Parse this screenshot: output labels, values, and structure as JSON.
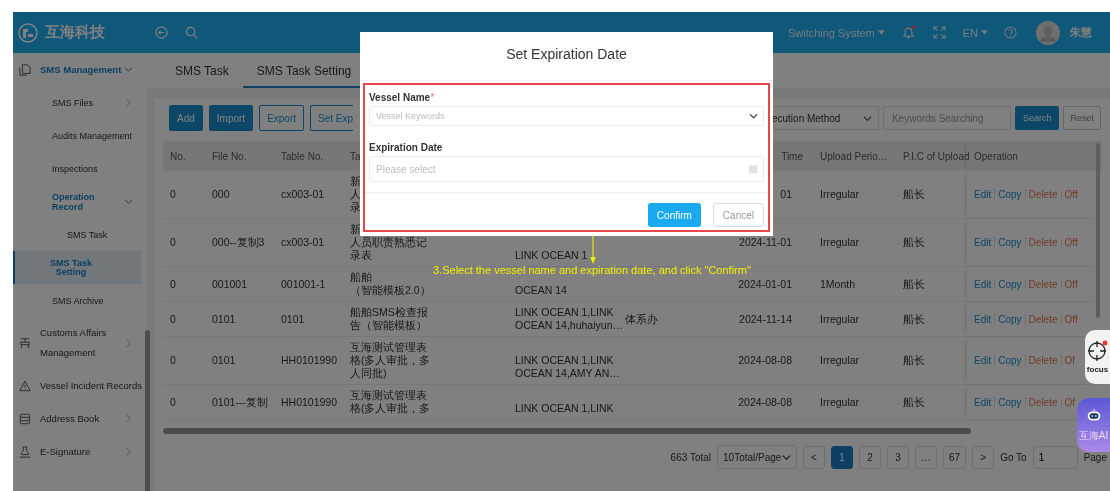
{
  "header": {
    "logo": "互海科技",
    "system_switch": "Switching System",
    "system_switch_expanded": false,
    "language": "EN",
    "language_expanded": false,
    "user_name": "朱慧",
    "has_notification": true
  },
  "sidebar": {
    "items": [
      {
        "label": "SMS Management",
        "expanded": true,
        "selected": false,
        "children": [
          {
            "label": "SMS Files",
            "expanded": false,
            "selected": false
          },
          {
            "label": "Audits Management",
            "selected": false
          },
          {
            "label": "Inspections",
            "selected": false
          },
          {
            "label": "Operation Record",
            "expanded": true,
            "selected": false,
            "children": [
              {
                "label": "SMS Task",
                "selected": false
              },
              {
                "label": "SMS Task Setting",
                "selected": true
              }
            ]
          },
          {
            "label": "SMS Archive",
            "selected": false
          }
        ]
      },
      {
        "label": "Customs Affairs Management",
        "expanded": false,
        "selected": false
      },
      {
        "label": "Vessel Incident Records",
        "selected": false
      },
      {
        "label": "Address Book",
        "expanded": false,
        "selected": false
      },
      {
        "label": "E-Signature",
        "expanded": false,
        "selected": false
      }
    ]
  },
  "tabs": [
    {
      "label": "SMS Task",
      "selected": false
    },
    {
      "label": "SMS Task Setting",
      "selected": true
    }
  ],
  "toolbar": {
    "buttons": [
      {
        "label": "Add",
        "kind": "primary"
      },
      {
        "label": "Import",
        "kind": "primary"
      },
      {
        "label": "Export",
        "kind": "outline"
      },
      {
        "label": "Set Exp",
        "kind": "outline"
      }
    ],
    "filter_select": "ecution Method",
    "search": {
      "placeholder": "Keywords Searching"
    },
    "search_button": "Search",
    "reset_button": "Reset"
  },
  "table": {
    "columns": {
      "no": "No.",
      "file_no": "File No.",
      "table_no": "Table No.",
      "column_4": "Ta",
      "column_7": "Time",
      "upload_period": "Upload Perio…",
      "pic": "P.I.C of Upload",
      "operation": "Operation"
    },
    "rows": [
      {
        "no": "0",
        "file_no": "000",
        "table_no": "cx003-01",
        "column_4": [
          "新",
          "人",
          "录"
        ],
        "column_7": "01",
        "upload_period": "Irregular",
        "pic": "船长",
        "actions": [
          {
            "label": "Edit",
            "kind": "edit"
          },
          {
            "label": "Copy",
            "kind": "copy"
          },
          {
            "label": "Delete",
            "kind": "delete"
          },
          {
            "label": "Off",
            "kind": "off"
          }
        ]
      },
      {
        "no": "0",
        "file_no": "000--复制3",
        "table_no": "cx003-01",
        "column_4": [
          "新",
          "人员职责熟悉记",
          "录表"
        ],
        "column_5": "LINK OCEAN 1",
        "column_7": "2024-11-01",
        "upload_period": "Irregular",
        "pic": "船长",
        "actions": [
          {
            "label": "Edit",
            "kind": "edit"
          },
          {
            "label": "Copy",
            "kind": "copy"
          },
          {
            "label": "Delete",
            "kind": "delete"
          },
          {
            "label": "Off",
            "kind": "off"
          }
        ]
      },
      {
        "no": "0",
        "file_no": "001001",
        "table_no": "001001-1",
        "column_4": [
          "船舶",
          "（智能模板2.0）"
        ],
        "column_5": "OCEAN 14",
        "column_7": "2024-01-01",
        "upload_period": "1Month",
        "pic": "船长",
        "actions": [
          {
            "label": "Edit",
            "kind": "edit"
          },
          {
            "label": "Copy",
            "kind": "copy"
          },
          {
            "label": "Delete",
            "kind": "delete"
          },
          {
            "label": "Off",
            "kind": "off"
          }
        ]
      },
      {
        "no": "0",
        "file_no": "0101",
        "table_no": "0101",
        "column_4": [
          "船舶SMS检查报",
          "告（智能模板）"
        ],
        "column_5": [
          "LINK OCEAN 1,LINK",
          "OCEAN 14,huhaiyun…"
        ],
        "column_6": "体系办",
        "column_7": "2024-11-14",
        "upload_period": "Irregular",
        "pic": "船长",
        "actions": [
          {
            "label": "Edit",
            "kind": "edit"
          },
          {
            "label": "Copy",
            "kind": "copy"
          },
          {
            "label": "Delete",
            "kind": "delete"
          },
          {
            "label": "Off",
            "kind": "off"
          }
        ]
      },
      {
        "no": "0",
        "file_no": "0101",
        "table_no": "HH0101990",
        "column_4": [
          "互海测试管理表",
          "格(多人审批，多",
          "人同批)"
        ],
        "column_5": [
          "LINK OCEAN 1,LINK",
          "OCEAN 14,AMY AN…"
        ],
        "column_7": "2024-08-08",
        "upload_period": "Irregular",
        "pic": "船长",
        "actions": [
          {
            "label": "Edit",
            "kind": "edit"
          },
          {
            "label": "Copy",
            "kind": "copy"
          },
          {
            "label": "Delete",
            "kind": "delete"
          },
          {
            "label": "Of",
            "kind": "off"
          }
        ]
      },
      {
        "no": "0",
        "file_no": "0101---复制",
        "table_no": "HH0101990",
        "column_4": [
          "互海测试管理表",
          "格(多人审批，多"
        ],
        "column_5": "LINK OCEAN 1,LINK",
        "column_7": "2024-08-08",
        "upload_period": "Irregular",
        "pic": "船长",
        "actions": [
          {
            "label": "Edit",
            "kind": "edit"
          },
          {
            "label": "Copy",
            "kind": "copy"
          },
          {
            "label": "Delete",
            "kind": "delete"
          },
          {
            "label": "Of",
            "kind": "off"
          }
        ]
      }
    ]
  },
  "pagination": {
    "total": "663 Total",
    "page_size": "10Total/Page",
    "prev": "<",
    "next": ">",
    "pages": [
      {
        "label": "1",
        "selected": true
      },
      {
        "label": "2",
        "selected": false
      },
      {
        "label": "3",
        "selected": false
      },
      {
        "label": "…",
        "selected": false
      },
      {
        "label": "67",
        "selected": false
      }
    ],
    "goto_label": "Go To",
    "goto_value": "1",
    "page_label": "Page"
  },
  "modal": {
    "title": "Set Expiration Date",
    "fields": [
      {
        "label": "Vessel Name",
        "required_mark": "*",
        "kind": "select",
        "placeholder": "Vessel Keywords"
      },
      {
        "label": "Expiration Date",
        "kind": "date",
        "placeholder": "Please select"
      }
    ],
    "confirm": "Confirm",
    "cancel": "Cancel"
  },
  "annotation": {
    "text": "3.Select the vessel name and expiration date, and click \"Confirm\""
  },
  "widgets": {
    "focus_label": "focus",
    "focus_alert": true,
    "ai_label": "互海AI"
  }
}
